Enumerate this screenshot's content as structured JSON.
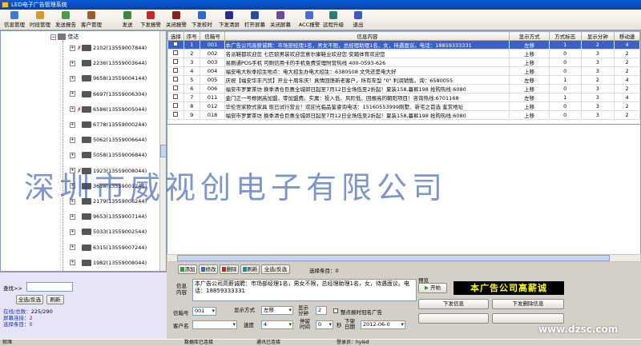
{
  "window": {
    "title": "LED电子广告管理系统"
  },
  "toolbar": [
    {
      "label": "信息管理",
      "icon": "info-manage-icon",
      "color": "#3a7bd5"
    },
    {
      "label": "时段管理",
      "icon": "clock-icon",
      "color": "#d59a2a"
    },
    {
      "label": "发送报告",
      "icon": "report-icon",
      "color": "#4a9a4a"
    },
    {
      "label": "客户管理",
      "icon": "customer-icon",
      "color": "#a05a2a"
    },
    {
      "label": "发送",
      "icon": "send-icon",
      "color": "#3a8a3a"
    },
    {
      "label": "下发报警",
      "icon": "alarm-icon",
      "color": "#c62828"
    },
    {
      "label": "关闭报警",
      "icon": "alarm-off-icon",
      "color": "#8a2020"
    },
    {
      "label": "下发校时",
      "icon": "time-sync-icon",
      "color": "#2a6ac8"
    },
    {
      "label": "下发清屏",
      "icon": "clear-screen-icon",
      "color": "#2a2a8a"
    },
    {
      "label": "打开屏幕",
      "icon": "screen-on-icon",
      "color": "#2a4aa8"
    },
    {
      "label": "关闭屏幕",
      "icon": "screen-off-icon",
      "color": "#6a4a9a"
    },
    {
      "label": "ACC报警",
      "icon": "acc-alarm-icon",
      "color": "#4a6ad8"
    },
    {
      "label": "远程升级",
      "icon": "remote-upgrade-icon",
      "color": "#2a7a7a"
    },
    {
      "label": "退出",
      "icon": "exit-icon",
      "color": "#3a5ac8"
    }
  ],
  "tree": {
    "root": "佳达",
    "nodes": [
      {
        "label": "2102(13559007844)",
        "status": "offline"
      },
      {
        "label": "2236(13559003644)",
        "status": "online"
      },
      {
        "label": "9658(13559004144)",
        "status": "online"
      },
      {
        "label": "6697(13559006304)",
        "status": "online"
      },
      {
        "label": "6586(13559005044)",
        "status": "offline"
      },
      {
        "label": "6778(13559000244)",
        "status": "online"
      },
      {
        "label": "5062(13559006644)",
        "status": "online"
      },
      {
        "label": "5058(13559006844)",
        "status": "online"
      },
      {
        "label": "1923(13559008044)",
        "status": "offline"
      },
      {
        "label": "3638(13559001244)",
        "status": "online"
      },
      {
        "label": "2179(13559006244)",
        "status": "online"
      },
      {
        "label": "9653(13559007144)",
        "status": "online"
      },
      {
        "label": "5033(13559002544)",
        "status": "online"
      },
      {
        "label": "6315(13559007244)",
        "status": "online"
      },
      {
        "label": "1982(13559008044)",
        "status": "online"
      }
    ]
  },
  "search": {
    "label": "查找>>",
    "value": ""
  },
  "left_buttons": {
    "select_all": "全选/反选",
    "refresh": "刷新"
  },
  "stats": {
    "online": "在线/总数：",
    "online_val": "225/290",
    "screen_conn": "屏幕连接：",
    "screen_conn_val": "2",
    "selected": "选择条目：",
    "selected_val": "0"
  },
  "table": {
    "columns": [
      "选择",
      "序号",
      "信箱号",
      "信息内容",
      "显示方式",
      "方式标志",
      "显示分钟",
      "移动速"
    ],
    "rows": [
      {
        "no": "1",
        "box": "001",
        "msg": "本广告公司高薪诚聘：市场部经理1名，男女不限，总经理助理1名，女，待遇面议。电话：18859333331",
        "mode": "左移",
        "flag": "1",
        "min": "2",
        "speed": "4",
        "selected": true
      },
      {
        "no": "2",
        "box": "002",
        "msg": "名派鞋都欢迎您 七匹狼男装欢迎您意尔康鞋业欢迎您 安踏体育欢迎您",
        "mode": "上移",
        "flag": "0",
        "min": "3",
        "speed": "2"
      },
      {
        "no": "3",
        "box": "003",
        "msg": "易刷通POS手机 可刷信用卡的手机免费受理附营热线 400-0593-626",
        "mode": "上移",
        "flag": "0",
        "min": "3",
        "speed": "2"
      },
      {
        "no": "4",
        "box": "004",
        "msg": "福安电大秋季招生地点：电大招生办电大招生：6380508 文凭还是电大好",
        "mode": "上移",
        "flag": "0",
        "min": "3",
        "speed": "2"
      },
      {
        "no": "5",
        "box": "005",
        "msg": "庆祝【福安华丰汽贸】开业十周年庆！真情回馈新老客户，所有车型 \"0\" 利润销售。询：6580055",
        "mode": "左移",
        "flag": "1",
        "min": "2",
        "speed": "4"
      },
      {
        "no": "6",
        "box": "006",
        "msg": "福安市罗蒙茶坊 换季清仓巨惠全城郎日起至7月12日全场低至2折起！夏装158,暮裤198 抢购热线:6080",
        "mode": "上移",
        "flag": "0",
        "min": "3",
        "speed": "2"
      },
      {
        "no": "7",
        "box": "011",
        "msg": "金门正一号根据高加盟，零加盟费。实属：投入低、风险低、回报高的朝阳项目！咨询热线:6701168",
        "mode": "左移",
        "flag": "1",
        "min": "3",
        "speed": "4"
      },
      {
        "no": "8",
        "box": "012",
        "msg": "华伦世家欧式家具 现已试行营业！欢迎光临品鉴睿询电话：15160553999刚墅、新宅之首选 鉴赏地址",
        "mode": "上移",
        "flag": "0",
        "min": "3",
        "speed": "2"
      },
      {
        "no": "9",
        "box": "018",
        "msg": "福安市罗蒙茶坊 换季清仓巨惠全城郎日起至7月12日全场低至2折起！夏装158,暮裤198 抢购热线:6080",
        "mode": "上移",
        "flag": "0",
        "min": "3",
        "speed": "2"
      }
    ]
  },
  "watermark": "深圳市威视创电子有限公司",
  "actions": [
    {
      "label": "添加",
      "icon": "add-icon",
      "color": "#3a9a3a"
    },
    {
      "label": "修改",
      "icon": "edit-icon",
      "color": "#3a6ac8"
    },
    {
      "label": "删除",
      "icon": "delete-icon",
      "color": "#c62828"
    },
    {
      "label": "刷新",
      "icon": "refresh-icon",
      "color": "#2a8a8a"
    },
    {
      "label": "全选/反选",
      "icon": "",
      "color": ""
    }
  ],
  "select_count": "选择条目：0",
  "form": {
    "msg_label": "信息内容",
    "msg_value": "本广告公司高薪诚聘：市场部经理1名，男女不限，总经理助理1名，女，待遇面议。电话：18859333331",
    "box_label": "信箱号",
    "box_value": "001",
    "mode_label": "显示方式",
    "mode_value": "左移",
    "minutes_label": "显示分钟",
    "minutes_value": "2",
    "customer_label": "客户名",
    "customer_value": "",
    "speed_label": "速度",
    "speed_value": "4",
    "stay_label": "停留时间",
    "stay_value": "0",
    "sec_label": "秒",
    "date_label": "下架日期",
    "date_value": "2012-06-0",
    "check_label": "整点报时冠名广告"
  },
  "preview": {
    "title": "预览",
    "start": "开始",
    "led_text": "本广告公司高薪诚",
    "send_btn": "下发信息",
    "delete_send_btn": "下发删除信息",
    "btn3": "",
    "btn4": ""
  },
  "statusbar": {
    "ready": "就绪",
    "db": "数据库已连接",
    "comm": "通讯已连接",
    "operator": "登录员：hyled"
  },
  "corner_watermark": "www.dzsc.com"
}
